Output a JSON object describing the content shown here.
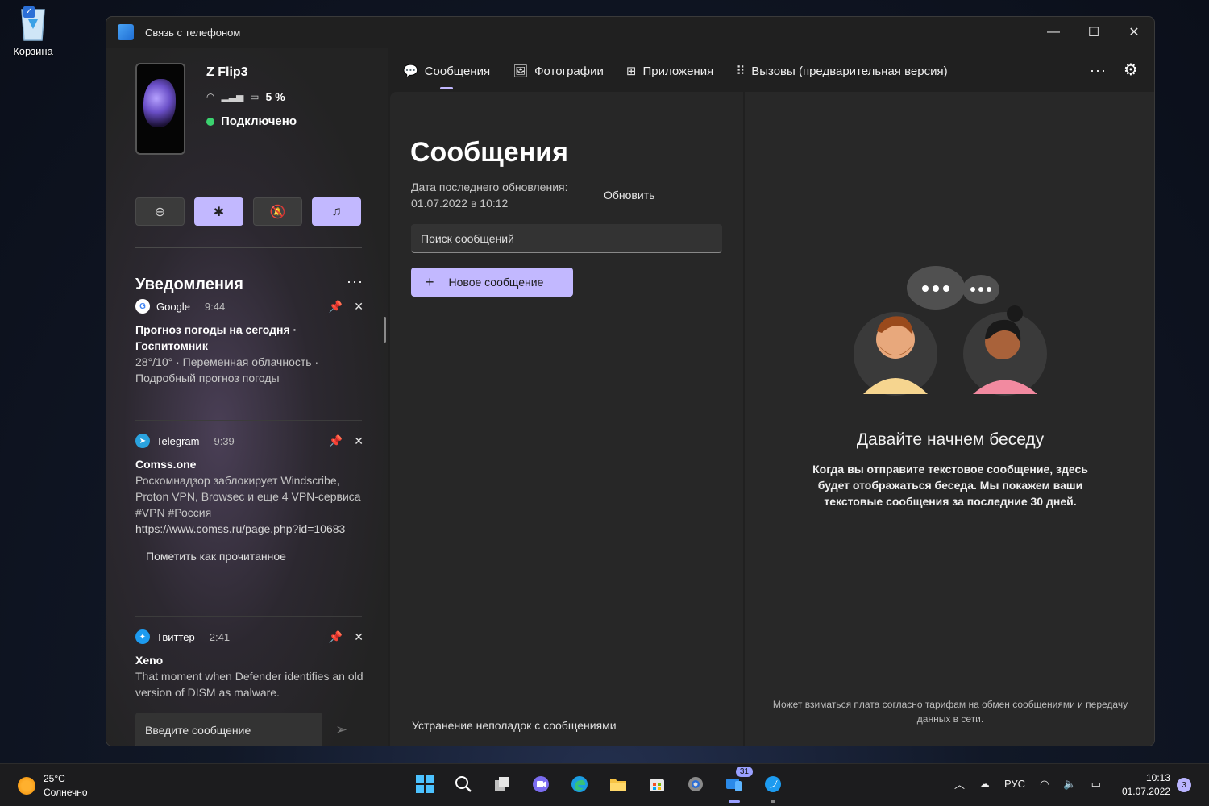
{
  "desktop": {
    "recycle_bin_label": "Корзина"
  },
  "window": {
    "title": "Связь с телефоном",
    "controls": {
      "minimize": "—",
      "maximize": "☐",
      "close": "✕"
    }
  },
  "device": {
    "name": "Z Flip3",
    "battery": "5 %",
    "status": "Подключено"
  },
  "quick_actions": [
    {
      "name": "dnd",
      "icon": "⊖",
      "active": false
    },
    {
      "name": "bluetooth",
      "icon": "✱",
      "active": true
    },
    {
      "name": "silent",
      "icon": "🔕",
      "active": false
    },
    {
      "name": "media",
      "icon": "♫",
      "active": true
    }
  ],
  "notifications": {
    "header": "Уведомления",
    "more": "···",
    "items": [
      {
        "app": "Google",
        "time": "9:44",
        "title": "Прогноз погоды на сегодня · Госпитомник",
        "body": "28°/10° · Переменная облачность · Подробный прогноз погоды"
      },
      {
        "app": "Telegram",
        "time": "9:39",
        "title": "Comss.one",
        "body": "Роскомнадзор заблокирует Windscribe, Proton VPN, Browsec и еще 4 VPN-сервиса  #VPN  #Россия",
        "link": "https://www.comss.ru/page.php?id=10683",
        "mark_read": "Пометить как прочитанное"
      },
      {
        "app": "Твиттер",
        "time": "2:41",
        "title": "Xeno",
        "body": "That moment when Defender identifies an old version of DISM as malware."
      }
    ],
    "reply_placeholder": "Введите сообщение"
  },
  "tabs": [
    {
      "label": "Сообщения",
      "icon": "💬",
      "active": true
    },
    {
      "label": "Фотографии",
      "icon": "🖼",
      "active": false
    },
    {
      "label": "Приложения",
      "icon": "⊞",
      "active": false
    },
    {
      "label": "Вызовы (предварительная версия)",
      "icon": "⠿",
      "active": false
    }
  ],
  "messages": {
    "title": "Сообщения",
    "last_update": "Дата последнего обновления: 01.07.2022 в 10:12",
    "refresh": "Обновить",
    "search_placeholder": "Поиск сообщений",
    "new_message": "Новое сообщение",
    "troubleshoot": "Устранение неполадок с сообщениями"
  },
  "conversation": {
    "headline": "Давайте начнем беседу",
    "description": "Когда вы отправите текстовое сообщение, здесь будет отображаться беседа. Мы покажем ваши текстовые сообщения за последние 30 дней.",
    "fine_print": "Может взиматься плата согласно тарифам на обмен сообщениями и передачу данных в сети."
  },
  "taskbar": {
    "weather_temp": "25°C",
    "weather_desc": "Солнечно",
    "phone_badge": "31",
    "language": "РУС",
    "time": "10:13",
    "date": "01.07.2022",
    "notification_count": "3"
  },
  "colors": {
    "accent": "#c2b8ff",
    "window_bg": "#202020",
    "panel_bg": "#272727",
    "status_green": "#3bd16f"
  }
}
